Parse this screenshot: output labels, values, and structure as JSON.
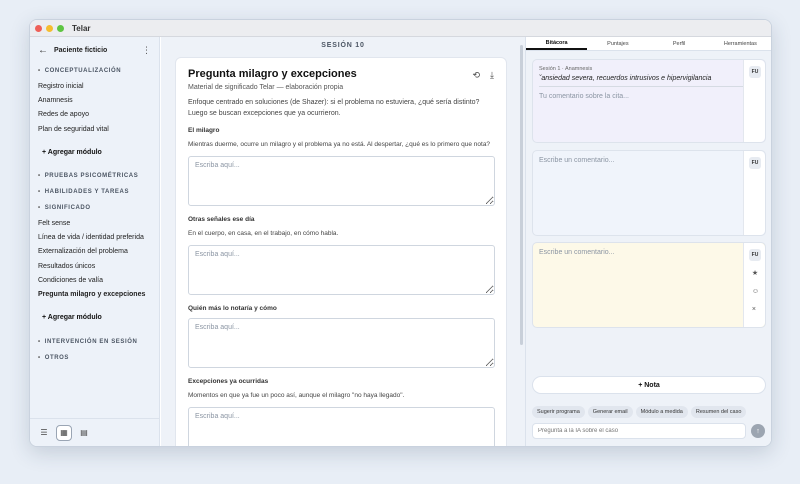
{
  "window": {
    "title": "Telar"
  },
  "sidebar": {
    "header": "Paciente ficticio",
    "sections": {
      "conceptualizacion": "CONCEPTUALIZACIÓN",
      "pruebas": "PRUEBAS PSICOMÉTRICAS",
      "habilidades": "HABILIDADES Y TAREAS",
      "significado": "SIGNIFICADO",
      "intervencion": "INTERVENCIÓN EN SESIÓN",
      "otros": "OTROS"
    },
    "concept_items": [
      "Registro inicial",
      "Anamnesis",
      "Redes de apoyo",
      "Plan de seguridad vital"
    ],
    "significado_items": [
      "Felt sense",
      "Línea de vida / identidad preferida",
      "Externalización del problema",
      "Resultados únicos",
      "Condiciones de valía",
      "Pregunta milagro y excepciones"
    ],
    "add_module": "+ Agregar módulo"
  },
  "center": {
    "session": "SESIÓN 10",
    "title": "Pregunta milagro y excepciones",
    "subtitle": "Material de significado Telar — elaboración propia",
    "description": "Enfoque centrado en soluciones (de Shazer): si el problema no estuviera, ¿qué sería distinto? Luego se buscan excepciones que ya ocurrieron.",
    "placeholder": "Escriba aquí...",
    "questions": [
      {
        "label": "El milagro",
        "help": "Mientras duerme, ocurre un milagro y el problema ya no está. Al despertar, ¿qué es lo primero que nota?"
      },
      {
        "label": "Otras señales ese día",
        "help": "En el cuerpo, en casa, en el trabajo, en cómo habla."
      },
      {
        "label": "Quién más lo notaría y cómo",
        "help": ""
      },
      {
        "label": "Excepciones ya ocurridas",
        "help": "Momentos en que ya fue un poco así, aunque el milagro \"no haya llegado\"."
      }
    ]
  },
  "right": {
    "tabs": [
      "Bitácora",
      "Puntajes",
      "Perfil",
      "Herramientas"
    ],
    "note1": {
      "meta": "Sesión 1 · Anamnesis",
      "quote": "˘ansiedad severa, recuerdos intrusivos e hipervigilancia",
      "placeholder": "Tu comentario sobre la cita...",
      "badge": "FU"
    },
    "note2": {
      "placeholder": "Escribe un comentario...",
      "badge": "FU"
    },
    "note3": {
      "placeholder": "Escribe un comentario...",
      "badge": "FU"
    },
    "add_note": "+ Nota",
    "chips": [
      "Sugerir programa",
      "Generar email",
      "Módulo a medida",
      "Resumen del caso"
    ],
    "ai_placeholder": "Pregunta a la IA sobre el caso",
    "colors": {
      "note1_bg": "#f1f0fb",
      "note2_bg": "#f0f4fb",
      "note3_bg": "#fdf9e8"
    }
  }
}
